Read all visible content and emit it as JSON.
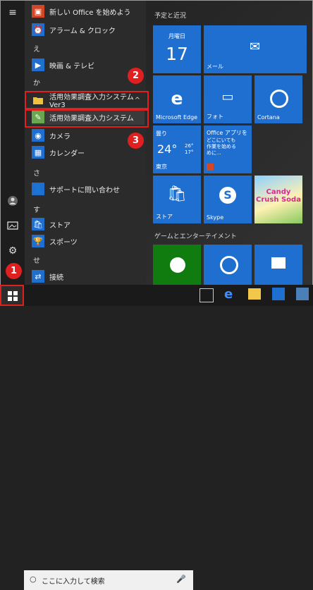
{
  "rail": {
    "icons": [
      "hamburger-icon",
      "user-icon",
      "pictures-icon",
      "settings-icon",
      "power-icon"
    ]
  },
  "apps": [
    {
      "label": "新しい Office を始めよう",
      "icon": "office-icon",
      "color": "#d24726"
    },
    {
      "label": "アラーム & クロック",
      "icon": "alarm-icon",
      "color": "#1f6fd1"
    }
  ],
  "section_e": "え",
  "apps_e": [
    {
      "label": "映画 & テレビ",
      "icon": "movies-icon",
      "color": "#1f6fd1"
    }
  ],
  "section_ka": "か",
  "folder": {
    "label": "活用効果調査入力システム Ver3",
    "chevron": "^"
  },
  "selected_app": {
    "label": "活用効果調査入力システム"
  },
  "apps_ka": [
    {
      "label": "カメラ",
      "icon": "camera-icon",
      "color": "#1f6fd1"
    },
    {
      "label": "カレンダー",
      "icon": "calendar-icon",
      "color": "#1f6fd1"
    }
  ],
  "section_sa": "さ",
  "apps_sa": [
    {
      "label": "サポートに問い合わせ",
      "icon": "support-icon",
      "color": "#1f6fd1"
    }
  ],
  "section_su": "す",
  "apps_su": [
    {
      "label": "ストア",
      "icon": "store-icon",
      "color": "#1f6fd1"
    },
    {
      "label": "スポーツ",
      "icon": "sports-icon",
      "color": "#1f6fd1"
    }
  ],
  "section_se": "せ",
  "apps_se": [
    {
      "label": "接続",
      "icon": "connect-icon",
      "color": "#1f6fd1"
    }
  ],
  "tiles_header": "予定と近況",
  "tiles": {
    "calendar": {
      "day": "月曜日",
      "date": "17"
    },
    "mail": {
      "label": "メール"
    },
    "edge": {
      "label": "Microsoft Edge"
    },
    "photos": {
      "label": "フォト"
    },
    "cortana": {
      "label": "Cortana"
    },
    "weather": {
      "cond": "曇り",
      "temp": "24°",
      "hi": "26°",
      "lo": "17°",
      "city": "東京"
    },
    "office_app": {
      "line1": "Office アプリを",
      "line2": "どこにいても",
      "line3": "作業を始める",
      "line4": "めに..."
    },
    "store": {
      "label": "ストア"
    },
    "skype": {
      "label": "Skype"
    },
    "candy": {
      "label": "Candy Crush Soda"
    }
  },
  "games_header": "ゲームとエンターテイメント",
  "search": {
    "placeholder": "ここに入力して検索"
  },
  "callouts": {
    "one": "1",
    "two": "2",
    "three": "3"
  },
  "colors": {
    "accent": "#1f6fd1",
    "highlight": "#e02020"
  }
}
